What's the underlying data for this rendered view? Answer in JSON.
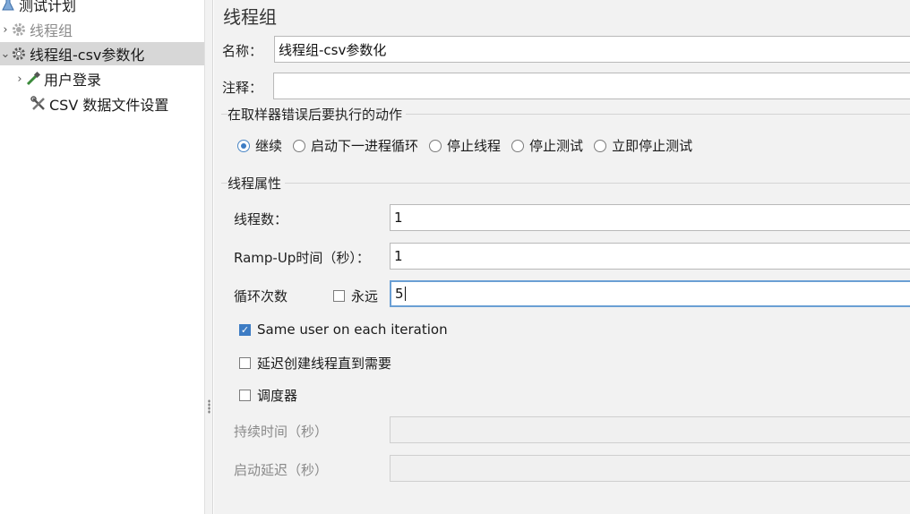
{
  "tree": {
    "items": [
      {
        "label": "测试计划"
      },
      {
        "label": "线程组"
      },
      {
        "label": "线程组-csv参数化"
      },
      {
        "label": "用户登录"
      },
      {
        "label": "CSV 数据文件设置"
      }
    ]
  },
  "panel": {
    "title": "线程组",
    "name_label": "名称：",
    "name_value": "线程组-csv参数化",
    "comment_label": "注释：",
    "comment_value": "",
    "error_group_title": "在取样器错误后要执行的动作",
    "error_actions": [
      {
        "label": "继续",
        "selected": true
      },
      {
        "label": "启动下一进程循环",
        "selected": false
      },
      {
        "label": "停止线程",
        "selected": false
      },
      {
        "label": "停止测试",
        "selected": false
      },
      {
        "label": "立即停止测试",
        "selected": false
      }
    ],
    "thread_group_title": "线程属性",
    "threads_label": "线程数：",
    "threads_value": "1",
    "rampup_label": "Ramp-Up时间（秒）：",
    "rampup_value": "1",
    "loop_label": "循环次数",
    "forever_label": "永远",
    "forever_checked": false,
    "loop_value": "5",
    "same_user_label": "Same user on each iteration",
    "same_user_checked": true,
    "delay_label": "延迟创建线程直到需要",
    "delay_checked": false,
    "scheduler_label": "调度器",
    "scheduler_checked": false,
    "duration_label": "持续时间（秒）",
    "duration_value": "",
    "startup_delay_label": "启动延迟（秒）",
    "startup_delay_value": ""
  },
  "colors": {
    "accent": "#3d7cc4",
    "selected_row": "#d7d7d7",
    "panel_bg": "#f2f2f2"
  }
}
